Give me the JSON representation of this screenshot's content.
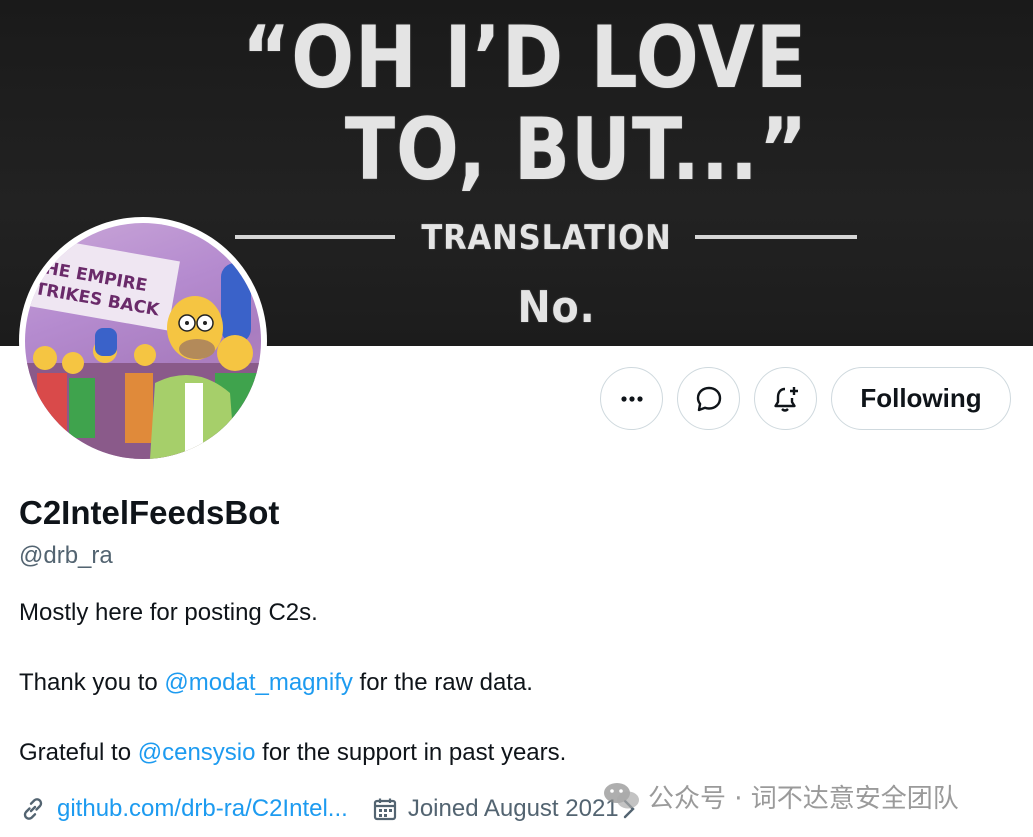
{
  "banner": {
    "line1": "“OH I’D LOVE",
    "line2": "TO, BUT...”",
    "line3": "TRANSLATION",
    "line4": "No."
  },
  "avatar": {
    "sign_line1": "HE EMPIRE",
    "sign_line2": "TRIKES BACK"
  },
  "actions": {
    "more_icon": "ellipsis-icon",
    "message_icon": "message-bubble-icon",
    "notify_icon": "bell-plus-icon",
    "following_label": "Following"
  },
  "profile": {
    "display_name": "C2IntelFeedsBot",
    "handle": "@drb_ra",
    "bio": {
      "line1": "Mostly here for posting C2s.",
      "line2_prefix": "Thank you to ",
      "line2_mention": "@modat_magnify",
      "line2_suffix": " for the raw data.",
      "line3_prefix": "Grateful to ",
      "line3_mention": "@censysio",
      "line3_suffix": " for the support in past years."
    },
    "website": "github.com/drb-ra/C2Intel...",
    "joined": "Joined August 2021"
  },
  "watermark": {
    "text": "公众号 · 词不达意安全团队"
  },
  "colors": {
    "accent": "#1d9bf0",
    "text_primary": "#0f1419",
    "text_secondary": "#536471",
    "border": "#cfd9de"
  }
}
